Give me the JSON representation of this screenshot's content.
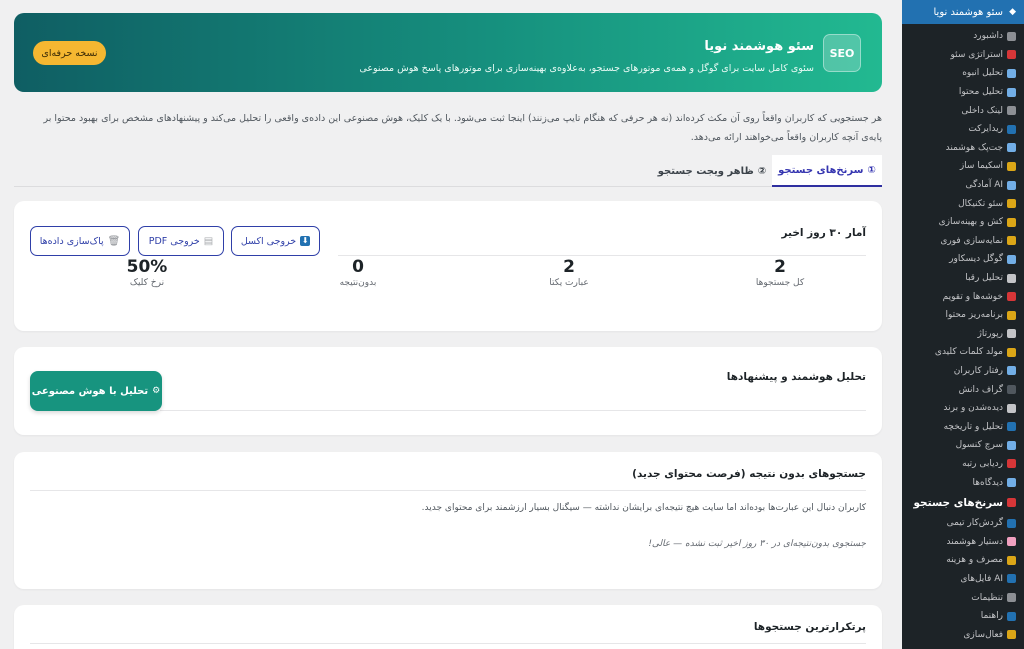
{
  "sidebar": {
    "top_label": "سئو هوشمند نویا",
    "items": [
      {
        "label": "داشبورد",
        "icon": "dashboard-icon",
        "color": "#8c8f94"
      },
      {
        "label": "استراتژی سئو",
        "icon": "target-icon",
        "color": "#d63638"
      },
      {
        "label": "تحلیل انبوه",
        "icon": "rocket-icon",
        "color": "#72aee6"
      },
      {
        "label": "تحلیل محتوا",
        "icon": "search-icon",
        "color": "#72aee6"
      },
      {
        "label": "لینک داخلی",
        "icon": "link-icon",
        "color": "#8c8f94"
      },
      {
        "label": "ریدایرکت",
        "icon": "redirect-icon",
        "color": "#2271b1"
      },
      {
        "label": "جت‌پک هوشمند",
        "icon": "jetpack-icon",
        "color": "#72aee6"
      },
      {
        "label": "اسکیما ساز",
        "icon": "tag-icon",
        "color": "#dba617"
      },
      {
        "label": "آمادگی AI",
        "icon": "robot-icon",
        "color": "#72aee6"
      },
      {
        "label": "سئو تکنیکال",
        "icon": "tools-icon",
        "color": "#dba617"
      },
      {
        "label": "کش و بهینه‌سازی",
        "icon": "bolt-icon",
        "color": "#dba617"
      },
      {
        "label": "نمایه‌سازی فوری",
        "icon": "flash-icon",
        "color": "#dba617"
      },
      {
        "label": "گوگل دیسکاور",
        "icon": "discover-icon",
        "color": "#72aee6"
      },
      {
        "label": "تحلیل رقبا",
        "icon": "swords-icon",
        "color": "#c3c4c7"
      },
      {
        "label": "خوشه‌ها و تقویم",
        "icon": "calendar-icon",
        "color": "#d63638"
      },
      {
        "label": "برنامه‌ریز محتوا",
        "icon": "planner-icon",
        "color": "#dba617"
      },
      {
        "label": "رپورتاژ",
        "icon": "document-icon",
        "color": "#c3c4c7"
      },
      {
        "label": "مولد کلمات کلیدی",
        "icon": "key-icon",
        "color": "#dba617"
      },
      {
        "label": "رفتار کاربران",
        "icon": "users-icon",
        "color": "#72aee6"
      },
      {
        "label": "گراف دانش",
        "icon": "graph-icon",
        "color": "#50575e"
      },
      {
        "label": "دیده‌شدن و برند",
        "icon": "eye-icon",
        "color": "#c3c4c7"
      },
      {
        "label": "تحلیل و تاریخچه",
        "icon": "chart-icon",
        "color": "#2271b1"
      },
      {
        "label": "سرچ کنسول",
        "icon": "console-icon",
        "color": "#72aee6"
      },
      {
        "label": "ردیابی رتبه",
        "icon": "pin-icon",
        "color": "#d63638"
      },
      {
        "label": "دیدگاه‌ها",
        "icon": "comment-icon",
        "color": "#72aee6"
      },
      {
        "label": "سرنخ‌های جستجو",
        "icon": "search-clues-icon",
        "color": "#d63638",
        "active": true
      },
      {
        "label": "گردش‌کار تیمی",
        "icon": "workflow-icon",
        "color": "#2271b1"
      },
      {
        "label": "دستیار هوشمند",
        "icon": "brain-icon",
        "color": "#f0a0c0"
      },
      {
        "label": "مصرف و هزینه",
        "icon": "money-icon",
        "color": "#dba617"
      },
      {
        "label": "فایل‌های AI",
        "icon": "files-icon",
        "color": "#2271b1"
      },
      {
        "label": "تنظیمات",
        "icon": "gear-icon",
        "color": "#8c8f94"
      },
      {
        "label": "راهنما",
        "icon": "book-icon",
        "color": "#2271b1"
      },
      {
        "label": "فعال‌سازی",
        "icon": "lock-icon",
        "color": "#dba617"
      }
    ]
  },
  "hero": {
    "badge": "SEO",
    "title": "سئو هوشمند نویا",
    "subtitle": "سئوی کامل سایت برای گوگل و همه‌ی موتورهای جستجو، به‌علاوه‌ی بهینه‌سازی برای موتورهای پاسخ هوش مصنوعی",
    "pro_button": "نسخه حرفه‌ای"
  },
  "intro": "هر جستجویی که کاربران واقعاً روی آن مکث کرده‌اند (نه هر حرفی که هنگام تایپ می‌زنند) اینجا ثبت می‌شود. با یک کلیک، هوش مصنوعی این داده‌ی واقعی را تحلیل می‌کند و پیشنهادهای مشخص برای بهبود محتوا بر پایه‌ی آنچه کاربران واقعاً می‌خواهند ارائه می‌دهد.",
  "tabs": [
    {
      "label": "سرنخ‌های جستجو",
      "num": "①"
    },
    {
      "label": "ظاهر ویجت جستجو",
      "num": "②"
    }
  ],
  "stats": {
    "title": "آمار ۳۰ روز اخیر",
    "buttons": {
      "excel": "خروجی اکسل",
      "pdf": "خروجی PDF",
      "clear": "پاک‌سازی داده‌ها"
    },
    "items": [
      {
        "value": "2",
        "label": "کل جستجوها"
      },
      {
        "value": "2",
        "label": "عبارت یکتا"
      },
      {
        "value": "0",
        "label": "بدون‌نتیجه"
      },
      {
        "value": "50%",
        "label": "نرخ کلیک"
      }
    ]
  },
  "ai": {
    "title": "تحلیل هوشمند و پیشنهادها",
    "button": "تحلیل با هوش مصنوعی"
  },
  "noresult": {
    "title": "جستجوهای بدون نتیجه (فرصت محتوای جدید)",
    "description": "کاربران دنبال این عبارت‌ها بوده‌اند اما سایت هیچ نتیجه‌ای برایشان نداشته — سیگنال بسیار ارزشمند برای محتوای جدید.",
    "empty": "جستجوی بدون‌نتیجه‌ای در ۳۰ روز اخیر ثبت نشده — عالی!"
  },
  "top": {
    "title": "پرتکرارترین جستجوها"
  }
}
